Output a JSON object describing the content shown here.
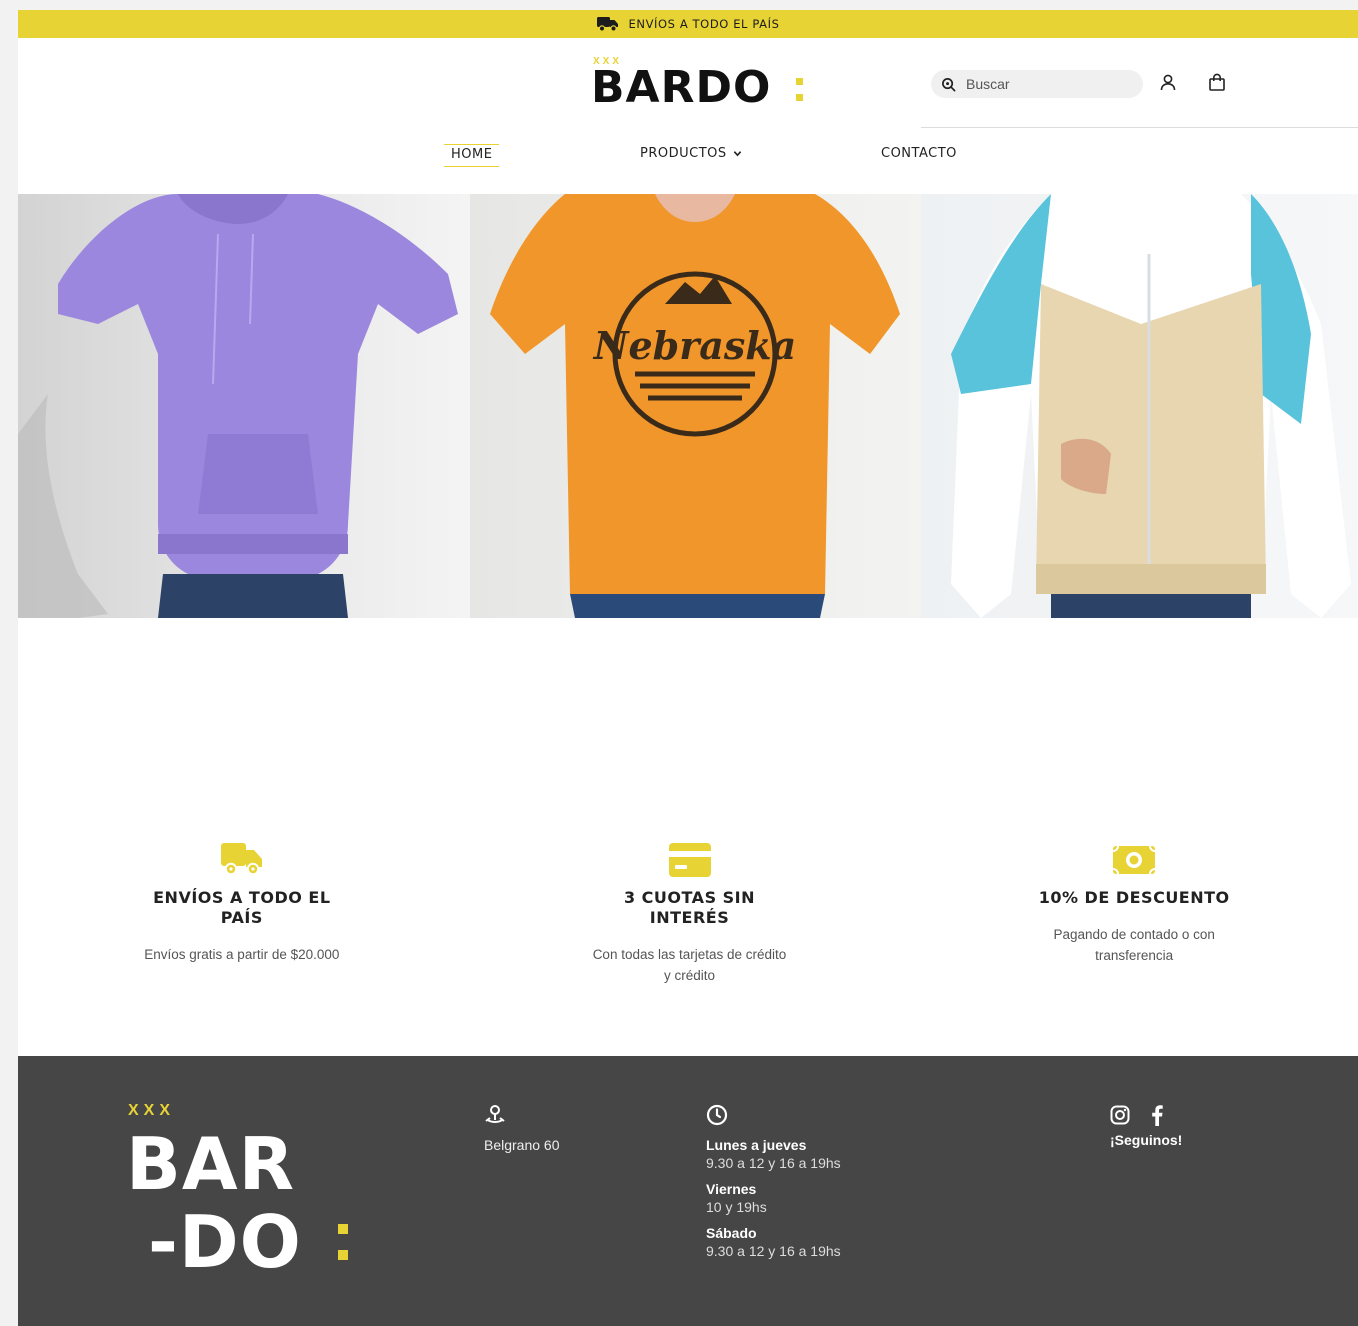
{
  "topbar": {
    "text": "Envíos a todo el país",
    "icon": "truck-icon"
  },
  "brand": {
    "logo_text": "BARDO",
    "logo_prefix": "XXX",
    "accent": "#e8d334"
  },
  "search": {
    "placeholder": "Buscar",
    "value": "",
    "icon": "search-icon"
  },
  "header_icons": [
    "user-icon",
    "shopping-bag-icon"
  ],
  "nav": {
    "items": [
      {
        "label": "Home",
        "active": true
      },
      {
        "label": "Productos",
        "has_dropdown": true
      },
      {
        "label": "Contacto"
      }
    ]
  },
  "hero": {
    "panels": [
      {
        "product": "Buzo con capucha lila",
        "color": "#9b87dd"
      },
      {
        "product": "Remera naranja Nebraska",
        "color": "#f0962a",
        "print_text": "Nebraska"
      },
      {
        "product": "Campera con capucha beige y celeste",
        "color": "#e7d6b0"
      }
    ]
  },
  "features": [
    {
      "icon": "truck-icon",
      "title": "Envíos a todo el país",
      "text": "Envíos gratis a partir de $20.000"
    },
    {
      "icon": "credit-card-icon",
      "title": "3 cuotas sin interés",
      "text": "Con todas las tarjetas de crédito y crédito"
    },
    {
      "icon": "cash-icon",
      "title": "10% de descuento",
      "text": "Pagando de contado o con transferencia"
    }
  ],
  "footer": {
    "logo_prefix": "XXX",
    "logo_line1": "BAR",
    "logo_line2": "-DO",
    "address": "Belgrano 60",
    "hours": [
      {
        "day": "Lunes a jueves",
        "time": "9.30 a 12 y 16 a 19hs"
      },
      {
        "day": "Viernes",
        "time": "10 y 19hs"
      },
      {
        "day": "Sábado",
        "time": "9.30 a 12 y 16 a 19hs"
      }
    ],
    "social_label": "¡Seguinos!",
    "social_icons": [
      "instagram-icon",
      "facebook-icon"
    ],
    "background": "#464646"
  }
}
